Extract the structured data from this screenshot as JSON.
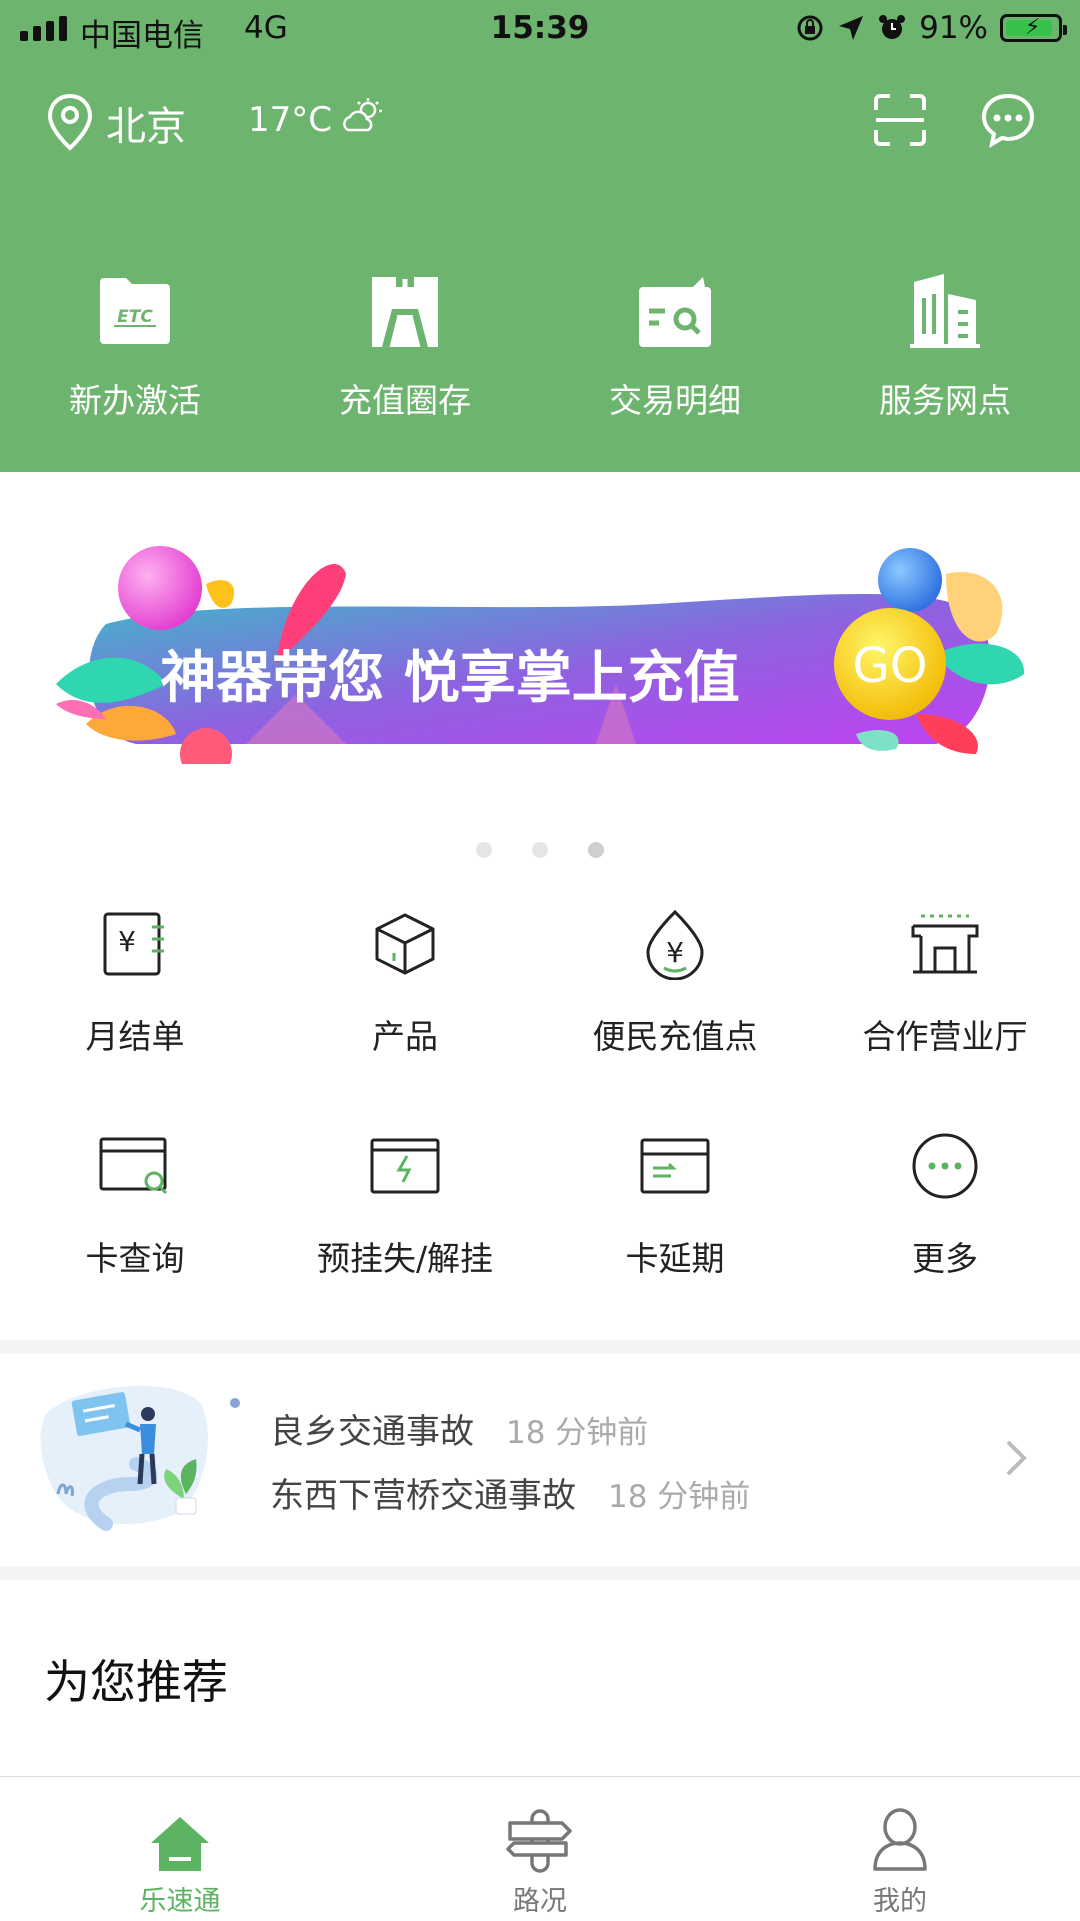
{
  "status_bar": {
    "carrier": "中国电信",
    "network": "4G",
    "time": "15:39",
    "battery": "91%",
    "battery_level": 0.91
  },
  "header": {
    "city": "北京",
    "temperature": "17°C",
    "weather_icon": "partly-cloudy-icon",
    "scan_icon": "scan-icon",
    "message_icon": "message-icon"
  },
  "quick_actions": [
    {
      "label": "新办激活",
      "icon": "etc-card-icon"
    },
    {
      "label": "充值圈存",
      "icon": "recharge-icon"
    },
    {
      "label": "交易明细",
      "icon": "transaction-search-icon"
    },
    {
      "label": "服务网点",
      "icon": "building-icon"
    }
  ],
  "banner": {
    "text": "神器带您 悦享掌上充值",
    "go": "GO",
    "page_count": 3,
    "active_page": 3
  },
  "services": [
    {
      "label": "月结单",
      "icon": "bill-icon"
    },
    {
      "label": "产品",
      "icon": "box-icon"
    },
    {
      "label": "便民充值点",
      "icon": "yen-drop-icon"
    },
    {
      "label": "合作营业厅",
      "icon": "store-icon"
    },
    {
      "label": "卡查询",
      "icon": "card-search-icon"
    },
    {
      "label": "预挂失/解挂",
      "icon": "card-lost-icon"
    },
    {
      "label": "卡延期",
      "icon": "card-extend-icon"
    },
    {
      "label": "更多",
      "icon": "more-icon"
    }
  ],
  "news": [
    {
      "title": "良乡交通事故",
      "time": "18 分钟前"
    },
    {
      "title": "东西下营桥交通事故",
      "time": "18 分钟前"
    }
  ],
  "recommend_title": "为您推荐",
  "tabs": [
    {
      "label": "乐速通",
      "icon": "home-icon",
      "active": true
    },
    {
      "label": "路况",
      "icon": "signpost-icon",
      "active": false
    },
    {
      "label": "我的",
      "icon": "user-icon",
      "active": false
    }
  ],
  "colors": {
    "brand_green": "#6db56e",
    "active_tab": "#5cb361"
  }
}
